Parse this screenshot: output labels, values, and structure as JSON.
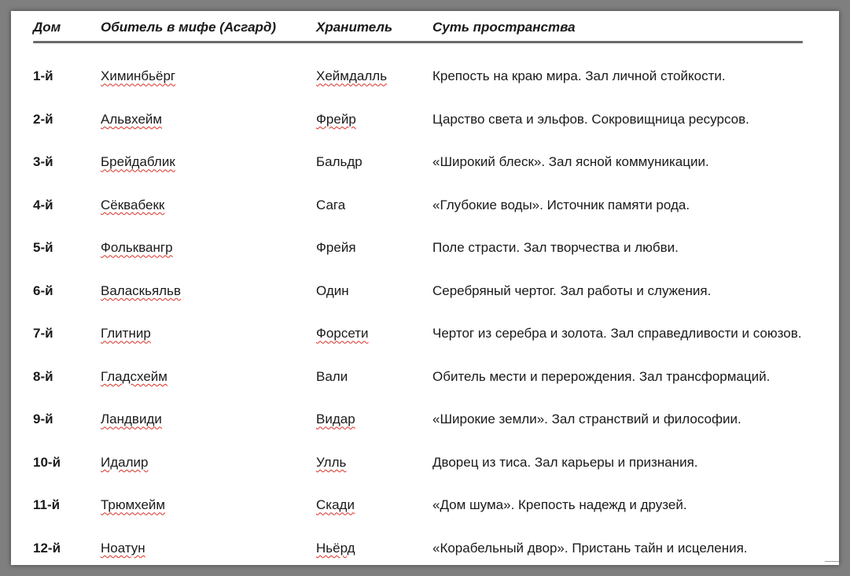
{
  "table": {
    "headers": [
      "Дом",
      "Обитель в мифе (Асгард)",
      "Хранитель",
      "Суть пространства"
    ],
    "rows": [
      {
        "house": "1-й",
        "abode": "Химинбьёрг",
        "keeper": "Хеймдалль",
        "essence": "Крепость на краю мира. Зал личной стойкости."
      },
      {
        "house": "2-й",
        "abode": "Альвхейм",
        "keeper": "Фрейр",
        "essence": "Царство света и эльфов. Сокровищница ресурсов."
      },
      {
        "house": "3-й",
        "abode": "Брейдаблик",
        "keeper": "Бальдр",
        "essence": "«Широкий блеск». Зал ясной коммуникации."
      },
      {
        "house": "4-й",
        "abode": "Сёквабекк",
        "keeper": "Сага",
        "essence": "«Глубокие воды». Источник памяти рода."
      },
      {
        "house": "5-й",
        "abode": "Фольквангр",
        "keeper": "Фрейя",
        "essence": "Поле страсти. Зал творчества и любви."
      },
      {
        "house": "6-й",
        "abode": "Валаскьяльв",
        "keeper": "Один",
        "essence": "Серебряный чертог. Зал работы и служения."
      },
      {
        "house": "7-й",
        "abode": "Глитнир",
        "keeper": "Форсети",
        "essence": "Чертог из серебра и золота. Зал справедливости и союзов."
      },
      {
        "house": "8-й",
        "abode": "Гладсхейм",
        "keeper": "Вали",
        "essence": "Обитель мести и перерождения. Зал трансформаций."
      },
      {
        "house": "9-й",
        "abode": "Ландвиди",
        "keeper": "Видар",
        "essence": "«Широкие земли». Зал странствий и философии."
      },
      {
        "house": "10-й",
        "abode": "Идалир",
        "keeper": "Улль",
        "essence": "Дворец из тиса. Зал карьеры и признания."
      },
      {
        "house": "11-й",
        "abode": "Трюмхейм",
        "keeper": "Скади",
        "essence": "«Дом шума». Крепость надежд и друзей."
      },
      {
        "house": "12-й",
        "abode": "Ноатун",
        "keeper": "Ньёрд",
        "essence": "«Корабельный двор». Пристань тайн и исцеления."
      }
    ]
  },
  "colors": {
    "frame": "#7f7f7f",
    "page": "#ffffff",
    "text": "#1a1a1a",
    "header_rule": "#6b6b6b",
    "spellcheck": "#d93025"
  }
}
